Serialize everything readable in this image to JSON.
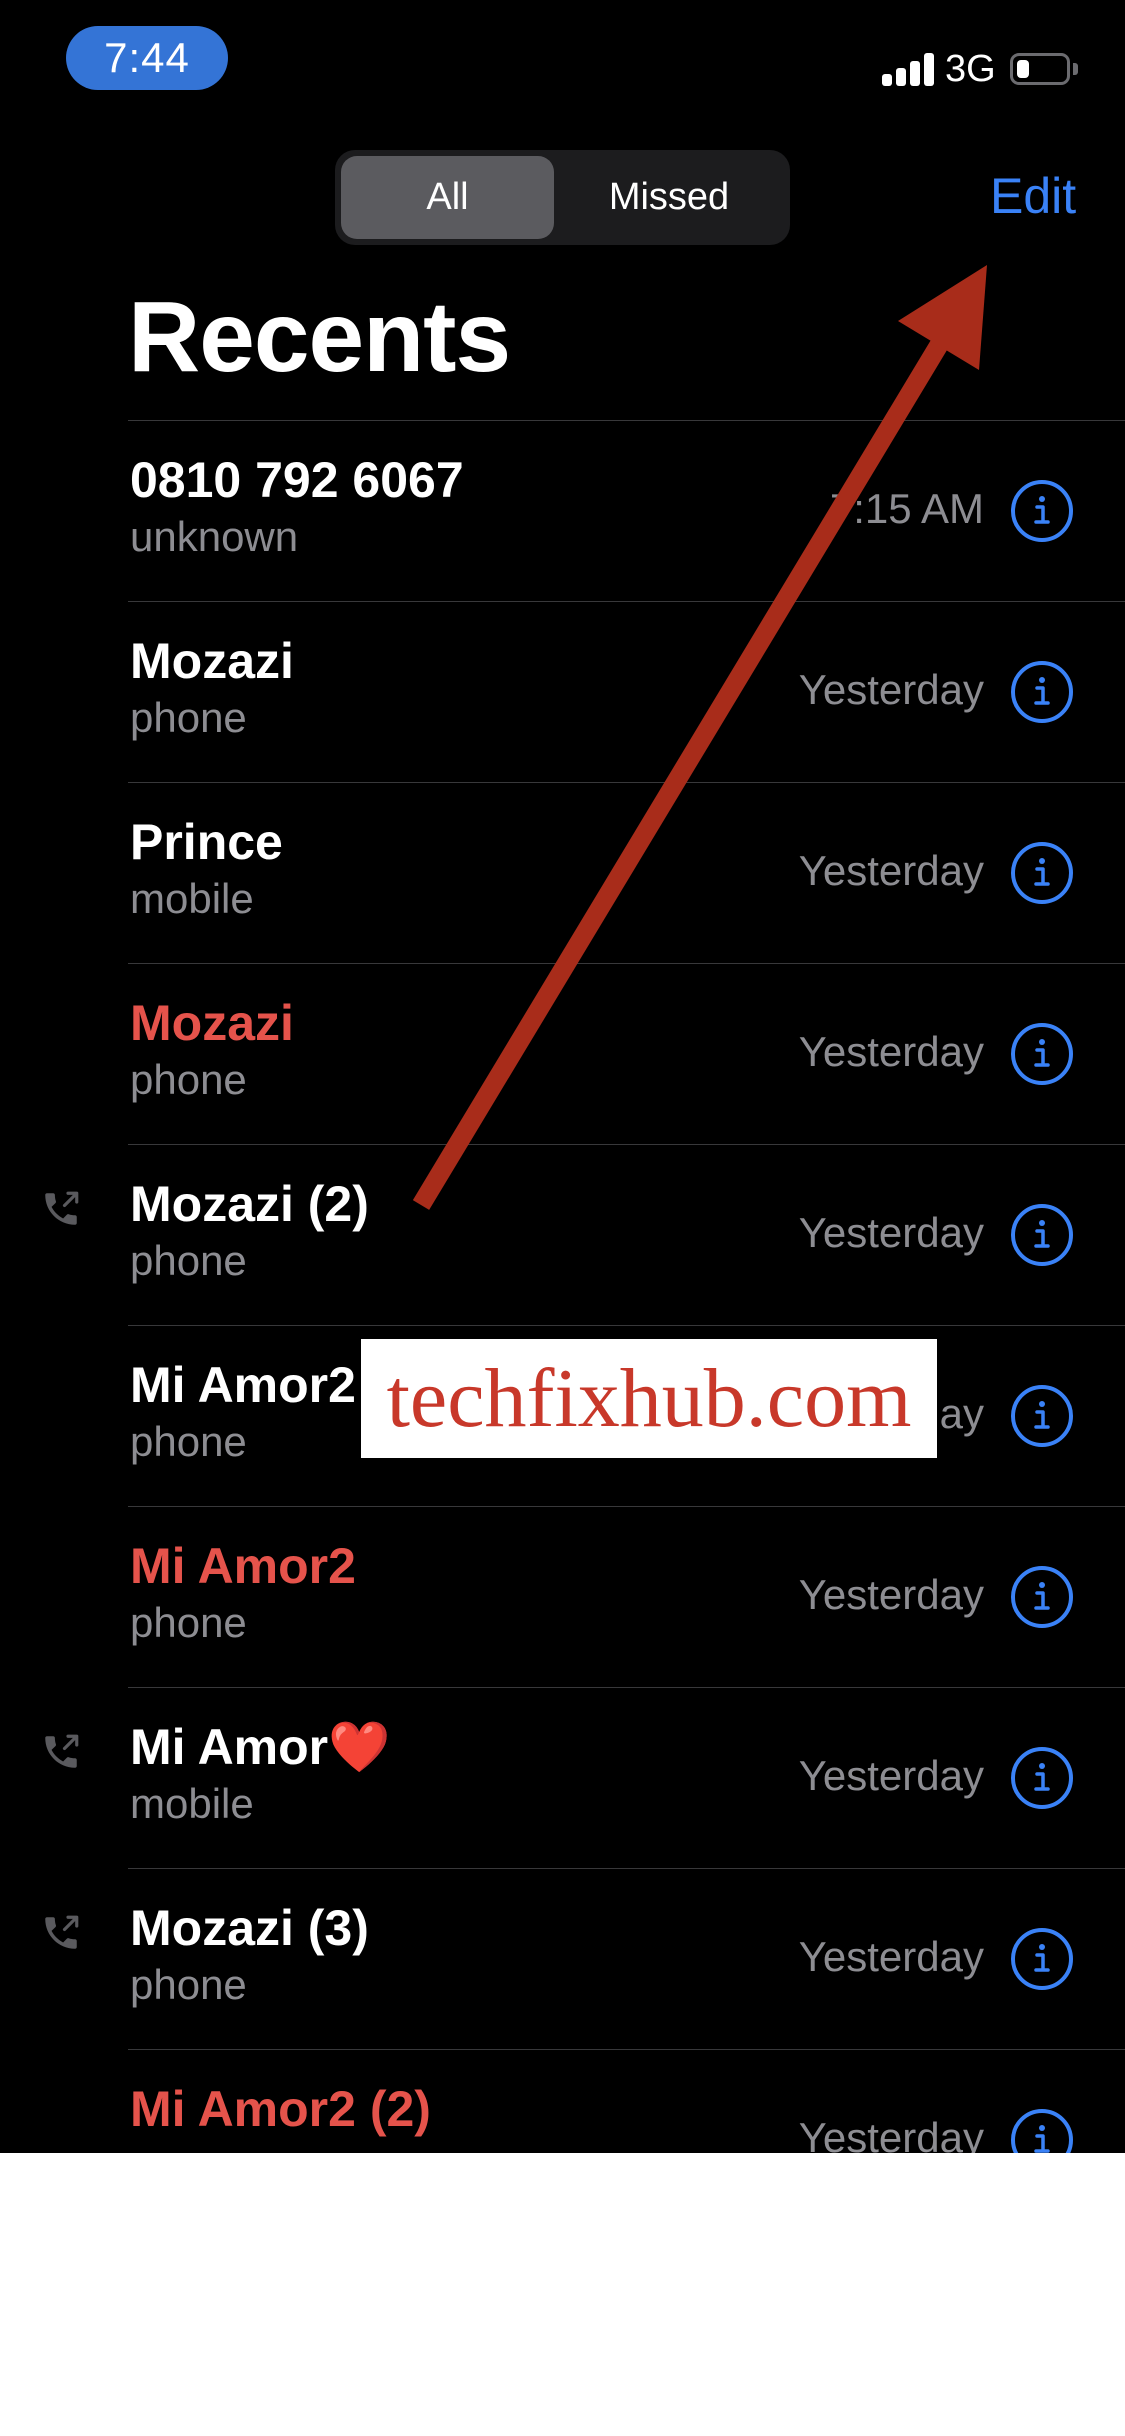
{
  "status_bar": {
    "time": "7:44",
    "network": "3G",
    "signal_bars": 4,
    "battery_level_percent": 25
  },
  "header": {
    "segments": [
      {
        "label": "All",
        "selected": true
      },
      {
        "label": "Missed",
        "selected": false
      }
    ],
    "edit_label": "Edit",
    "title": "Recents"
  },
  "calls": [
    {
      "name": "0810 792 6067",
      "type": "unknown",
      "time": "7:15 AM",
      "missed": false,
      "outgoing": false
    },
    {
      "name": "Mozazi",
      "type": "phone",
      "time": "Yesterday",
      "missed": false,
      "outgoing": false
    },
    {
      "name": "Prince",
      "type": "mobile",
      "time": "Yesterday",
      "missed": false,
      "outgoing": false
    },
    {
      "name": "Mozazi",
      "type": "phone",
      "time": "Yesterday",
      "missed": true,
      "outgoing": false
    },
    {
      "name": "Mozazi (2)",
      "type": "phone",
      "time": "Yesterday",
      "missed": false,
      "outgoing": true
    },
    {
      "name": "Mi Amor2",
      "type": "phone",
      "time": "Yesterday",
      "missed": false,
      "outgoing": false
    },
    {
      "name": "Mi Amor2",
      "type": "phone",
      "time": "Yesterday",
      "missed": true,
      "outgoing": false
    },
    {
      "name": "Mi Amor❤️",
      "type": "mobile",
      "time": "Yesterday",
      "missed": false,
      "outgoing": true
    },
    {
      "name": "Mozazi (3)",
      "type": "phone",
      "time": "Yesterday",
      "missed": false,
      "outgoing": true
    },
    {
      "name": "Mi Amor2 (2)",
      "type": "",
      "time": "Yesterday",
      "missed": true,
      "outgoing": false
    }
  ],
  "overlay": {
    "watermark": "techfixhub.com",
    "annotation": "arrow pointing to Edit"
  },
  "colors": {
    "accent": "#3a82f7",
    "missed": "#e5534b",
    "time_pill": "#3474d6",
    "arrow": "#a82c1a"
  }
}
